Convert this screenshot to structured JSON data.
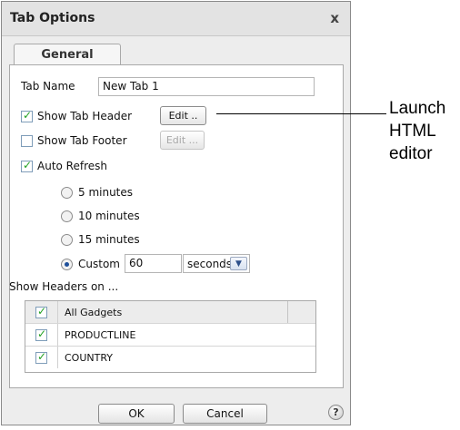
{
  "dialog": {
    "title": "Tab Options",
    "close_glyph": "x",
    "tab_label": "General"
  },
  "form": {
    "tab_name_label": "Tab Name",
    "tab_name_value": "New Tab 1",
    "show_header": {
      "label": "Show Tab Header",
      "checked": true,
      "edit_label": "Edit ..",
      "edit_enabled": true
    },
    "show_footer": {
      "label": "Show Tab Footer",
      "checked": false,
      "edit_label": "Edit ...",
      "edit_enabled": false
    },
    "auto_refresh": {
      "label": "Auto Refresh",
      "checked": true
    },
    "refresh_options": [
      {
        "label": "5 minutes",
        "selected": false
      },
      {
        "label": "10 minutes",
        "selected": false
      },
      {
        "label": "15 minutes",
        "selected": false
      },
      {
        "label": "Custom",
        "selected": true
      }
    ],
    "custom_value": "60",
    "custom_unit": "seconds",
    "show_headers_label": "Show Headers on ..."
  },
  "grid": {
    "header": {
      "label": "All Gadgets",
      "checked": true
    },
    "rows": [
      {
        "label": "PRODUCTLINE",
        "checked": true
      },
      {
        "label": "COUNTRY",
        "checked": true
      }
    ]
  },
  "footer": {
    "ok_label": "OK",
    "cancel_label": "Cancel",
    "help_glyph": "?"
  },
  "callout": {
    "line1": "Launch",
    "line2": "HTML",
    "line3": "editor"
  }
}
